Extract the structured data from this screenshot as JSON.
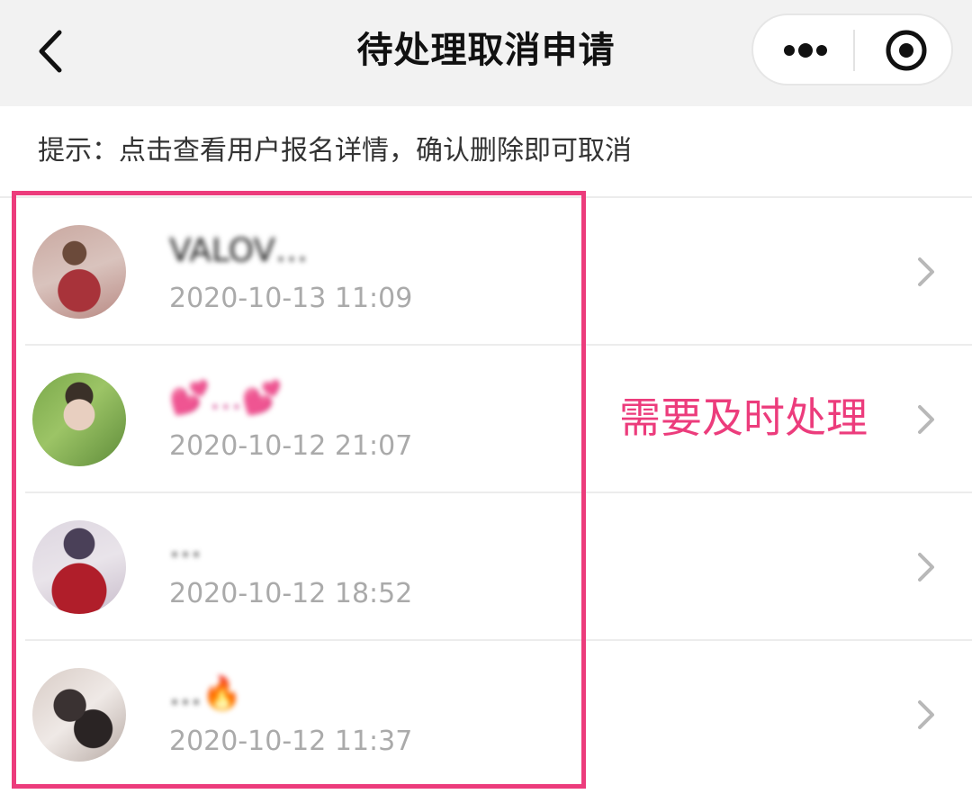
{
  "nav": {
    "title": "待处理取消申请",
    "back_icon": "chevron-left-icon",
    "more_icon": "more-dots-icon",
    "close_icon": "target-circle-icon"
  },
  "hint": "提示：点击查看用户报名详情，确认删除即可取消",
  "rows": [
    {
      "name": "VALOV…",
      "date": "2020-10-13 11:09"
    },
    {
      "name": "💕…💕",
      "date": "2020-10-12 21:07"
    },
    {
      "name": "…",
      "date": "2020-10-12 18:52"
    },
    {
      "name": "…🔥",
      "date": "2020-10-12 11:37"
    }
  ],
  "annotation": {
    "text": "需要及时处理",
    "color": "#ec3c7c"
  },
  "colors": {
    "nav_bg": "#f2f2f2",
    "date_text": "#aaaaaa",
    "highlight": "#ec3c7c"
  }
}
